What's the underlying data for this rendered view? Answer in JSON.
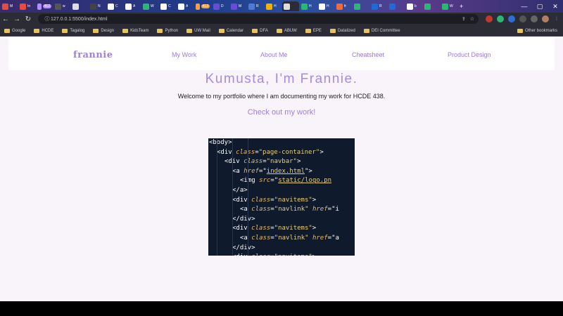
{
  "browser": {
    "tabs": [
      {
        "label": "M",
        "color": "#e94a3f"
      },
      {
        "label": "In",
        "color": "#e94a3f"
      },
      {
        "label": "412",
        "color": "#b48cff",
        "badge": true
      },
      {
        "label": "w",
        "color": "#555"
      },
      {
        "label": "",
        "color": "#ddd"
      },
      {
        "label": "N",
        "color": "#444"
      },
      {
        "label": "C",
        "color": "#fff"
      },
      {
        "label": "A",
        "color": "#fff"
      },
      {
        "label": "W",
        "color": "#2bb673"
      },
      {
        "label": "C",
        "color": "#fff"
      },
      {
        "label": "A",
        "color": "#fff"
      },
      {
        "label": "412",
        "color": "#f59e42",
        "badge": true
      },
      {
        "label": "D",
        "color": "#6a4bd6"
      },
      {
        "label": "M",
        "color": "#6a4bd6"
      },
      {
        "label": "R",
        "color": "#4e7ad6"
      },
      {
        "label": "H",
        "color": "#f0b400"
      },
      {
        "label": "",
        "color": "#ddd",
        "active": true
      },
      {
        "label": "H",
        "color": "#2bb673"
      },
      {
        "label": "H",
        "color": "#fff"
      },
      {
        "label": "fr",
        "color": "#f06a3f"
      },
      {
        "label": "",
        "color": "#2bb673"
      },
      {
        "label": "R",
        "color": "#1e6ad6"
      },
      {
        "label": "",
        "color": "#1e6ad6"
      },
      {
        "label": "b",
        "color": "#fff"
      },
      {
        "label": "",
        "color": "#2bb673"
      },
      {
        "label": "W",
        "color": "#2bb673"
      }
    ],
    "url": "127.0.0.1:5500/index.html",
    "bookmarks": [
      "Google",
      "HCDE",
      "Tagalog",
      "Design",
      "KidsTeam",
      "Python",
      "UW Mail",
      "Calendar",
      "DFA",
      "ABUW",
      "EPE",
      "Datalized",
      "DEI Committee"
    ],
    "other_bookmarks": "Other bookmarks"
  },
  "page": {
    "logo": "frannie",
    "nav": [
      "My Work",
      "About Me",
      "Cheatsheet",
      "Product Design"
    ],
    "title": "Kumusta, I'm Frannie.",
    "subtitle": "Welcome to my portfolio where I am documenting my work for HCDE 438.",
    "cta": "Check out my work!"
  },
  "code_lines": [
    {
      "indent": 0,
      "parts": [
        [
          "tag",
          "<body>"
        ]
      ]
    },
    {
      "indent": 1,
      "parts": [
        [
          "tag",
          "<div "
        ],
        [
          "attr",
          "class"
        ],
        [
          "tag",
          "="
        ],
        [
          "str",
          "\"page-container\""
        ],
        [
          "tag",
          ">"
        ]
      ]
    },
    {
      "indent": 2,
      "parts": [
        [
          "tag",
          "<div "
        ],
        [
          "attr",
          "class"
        ],
        [
          "tag",
          "="
        ],
        [
          "str",
          "\"navbar\""
        ],
        [
          "tag",
          ">"
        ]
      ]
    },
    {
      "indent": 3,
      "parts": [
        [
          "tag",
          "<a "
        ],
        [
          "attr",
          "href"
        ],
        [
          "tag",
          "=\""
        ],
        [
          "lnk",
          "index.html"
        ],
        [
          "tag",
          "\">"
        ]
      ]
    },
    {
      "indent": 4,
      "parts": [
        [
          "tag",
          "<img "
        ],
        [
          "attr",
          "src"
        ],
        [
          "tag",
          "=\""
        ],
        [
          "lnk",
          "static/logo.pn"
        ]
      ]
    },
    {
      "indent": 3,
      "parts": [
        [
          "tag",
          "</a>"
        ]
      ]
    },
    {
      "indent": 3,
      "parts": [
        [
          "tag",
          "<div "
        ],
        [
          "attr",
          "class"
        ],
        [
          "tag",
          "="
        ],
        [
          "str",
          "\"navitems\""
        ],
        [
          "tag",
          ">"
        ]
      ]
    },
    {
      "indent": 4,
      "parts": [
        [
          "tag",
          "<a "
        ],
        [
          "attr",
          "class"
        ],
        [
          "tag",
          "="
        ],
        [
          "str",
          "\"navlink\" "
        ],
        [
          "attr",
          "href"
        ],
        [
          "tag",
          "=\"i"
        ]
      ]
    },
    {
      "indent": 3,
      "parts": [
        [
          "tag",
          "</div>"
        ]
      ]
    },
    {
      "indent": 3,
      "parts": [
        [
          "tag",
          "<div "
        ],
        [
          "attr",
          "class"
        ],
        [
          "tag",
          "="
        ],
        [
          "str",
          "\"navitems\""
        ],
        [
          "tag",
          ">"
        ]
      ]
    },
    {
      "indent": 4,
      "parts": [
        [
          "tag",
          "<a "
        ],
        [
          "attr",
          "class"
        ],
        [
          "tag",
          "="
        ],
        [
          "str",
          "\"navlink\" "
        ],
        [
          "attr",
          "href"
        ],
        [
          "tag",
          "=\"a"
        ]
      ]
    },
    {
      "indent": 3,
      "parts": [
        [
          "tag",
          "</div>"
        ]
      ]
    },
    {
      "indent": 3,
      "parts": [
        [
          "tag",
          "<div "
        ],
        [
          "attr",
          "class"
        ],
        [
          "tag",
          "="
        ],
        [
          "str",
          "\"navitems\""
        ],
        [
          "tag",
          ">"
        ]
      ]
    }
  ]
}
